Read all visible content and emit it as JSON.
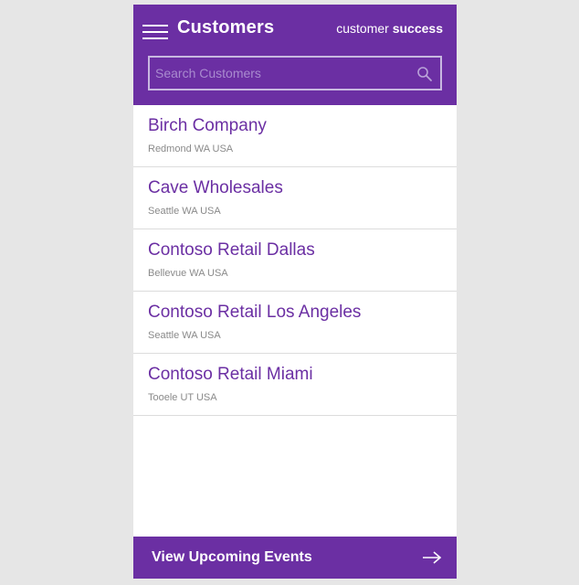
{
  "header": {
    "title": "Customers",
    "brand_light": "customer",
    "brand_bold": "success",
    "menu_icon": "hamburger-menu-icon"
  },
  "search": {
    "placeholder": "Search Customers",
    "value": "",
    "icon": "search-icon"
  },
  "customers": [
    {
      "name": "Birch Company",
      "location": "Redmond WA USA"
    },
    {
      "name": "Cave Wholesales",
      "location": "Seattle WA USA"
    },
    {
      "name": "Contoso Retail Dallas",
      "location": "Bellevue WA USA"
    },
    {
      "name": "Contoso Retail Los Angeles",
      "location": "Seattle WA USA"
    },
    {
      "name": "Contoso Retail Miami",
      "location": "Tooele UT USA"
    }
  ],
  "footer": {
    "label": "View Upcoming Events",
    "icon": "arrow-right-icon"
  },
  "colors": {
    "accent": "#6b2fa3",
    "background": "#e6e6e6",
    "location_text": "#8a8a8a"
  }
}
